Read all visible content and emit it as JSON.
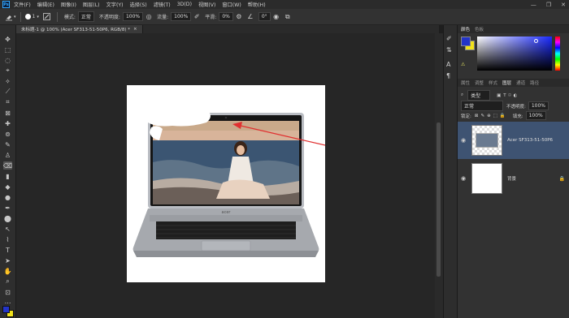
{
  "app": {
    "logo": "Ps"
  },
  "menu": [
    "文件(F)",
    "编辑(E)",
    "图像(I)",
    "图层(L)",
    "文字(Y)",
    "选择(S)",
    "滤镜(T)",
    "3D(D)",
    "视图(V)",
    "窗口(W)",
    "帮助(H)"
  ],
  "window_controls": {
    "minimize": "—",
    "restore": "❐",
    "close": "✕"
  },
  "options": {
    "brush_size": "1",
    "mode_label": "模式:",
    "mode_value": "正常",
    "opacity_label": "不透明度:",
    "opacity_value": "100%",
    "flow_label": "流量:",
    "flow_value": "100%",
    "smooth_label": "平滑:",
    "smooth_value": "0%",
    "angle_value": "0°"
  },
  "document_tab": {
    "title": "未标题-1 @ 100% (Acer SF313-51-50P6, RGB/8) *",
    "close": "×"
  },
  "color_panel": {
    "tabs": [
      "颜色",
      "色板"
    ],
    "fg": "#2334c8",
    "bg": "#f2e21a"
  },
  "layers_panel": {
    "tabs": [
      "属性",
      "调整",
      "样式",
      "图层",
      "通道",
      "路径"
    ],
    "kind_label": "类型",
    "blend_mode": "正常",
    "opacity_label": "不透明度:",
    "opacity_value": "100%",
    "lock_label": "锁定:",
    "fill_label": "填充:",
    "fill_value": "100%",
    "layers": [
      {
        "name": "Acer SF313-51-50P6",
        "selected": true
      },
      {
        "name": "背景",
        "selected": false
      }
    ]
  },
  "colors": {
    "accent": "#31a8ff",
    "selected_layer": "#3e5372",
    "brush_arrow": "#e03030"
  }
}
